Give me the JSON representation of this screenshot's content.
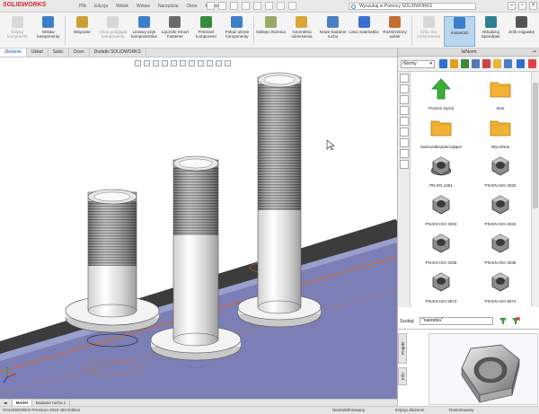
{
  "app": {
    "logo": "SOLIDWORKS"
  },
  "menu": [
    "Plik",
    "Edycja",
    "Widok",
    "Wstaw",
    "Narzędzia",
    "Okno",
    "Pomoc"
  ],
  "help_search": "Wyszukaj w Pomocy SOLIDWORKS",
  "ribbon": [
    {
      "label": "Edytuj komponent",
      "disabled": true
    },
    {
      "label": "Wstaw komponenty",
      "disabled": false
    },
    {
      "label": "Wiązanie",
      "disabled": false
    },
    {
      "label": "Okno podglądu komponentu",
      "disabled": true
    },
    {
      "label": "Liniowy szyk komponentów",
      "disabled": false
    },
    {
      "label": "Łączniki Smart Fastener",
      "disabled": false
    },
    {
      "label": "Przenieś komponent",
      "disabled": false
    },
    {
      "label": "Pokaż ukryte komponenty",
      "disabled": false
    },
    {
      "label": "Odstęp złożenia",
      "disabled": false
    },
    {
      "label": "Geometria odniesienia",
      "disabled": false
    },
    {
      "label": "Nowe badanie ruchu",
      "disabled": false
    },
    {
      "label": "Lista materiałów",
      "disabled": false
    },
    {
      "label": "Rozstrzelony widok",
      "disabled": false
    },
    {
      "label": "Szkic linii rozstrzelenia",
      "disabled": true
    },
    {
      "label": "Instant3D",
      "disabled": false,
      "active": true
    },
    {
      "label": "Aktualizuj Speedpak",
      "disabled": false
    },
    {
      "label": "Zrób migawkę",
      "disabled": false
    }
  ],
  "tabs": [
    "Złożenie",
    "Układ",
    "Szkic",
    "Ocen",
    "Dodatki SOLIDWORKS"
  ],
  "bottom_tabs": [
    "Model",
    "Badanie ruchu 1"
  ],
  "status": {
    "left": "SOLIDWORKS Premium 2016 x64 Edition",
    "s1": "Niedodefiniowany",
    "s2": "Edycja Złożenie",
    "s3": "Dostosowany"
  },
  "panel": {
    "title": "IsiNorm",
    "filter_value": "Normy",
    "items": [
      {
        "label": "Poziom wyżej",
        "kind": "up"
      },
      {
        "label": "Inne",
        "kind": "folder"
      },
      {
        "label": "Samozabezpieczające",
        "kind": "folder"
      },
      {
        "label": "Wycofane",
        "kind": "folder"
      },
      {
        "label": "PN-EN 1661",
        "kind": "nut-flange"
      },
      {
        "label": "PN-EN ISO 4032",
        "kind": "nut"
      },
      {
        "label": "PN-EN ISO 4033",
        "kind": "nut"
      },
      {
        "label": "PN-EN ISO 4034",
        "kind": "nut"
      },
      {
        "label": "PN-EN ISO 4035",
        "kind": "nut"
      },
      {
        "label": "PN-EN ISO 4036",
        "kind": "nut"
      },
      {
        "label": "PN-EN ISO 8673",
        "kind": "nut"
      },
      {
        "label": "PN-EN ISO 8674",
        "kind": "nut"
      }
    ],
    "search_label": "Szukaj:",
    "search_value": "\"nakrętka\"",
    "side_tabs": [
      "Projekt",
      "Info"
    ]
  },
  "colors": {
    "accent": "#0a4fa3",
    "folder": "#f2b233",
    "up_arrow": "#3cae3a",
    "beam_top": "#3a3a3a",
    "beam_side": "#7d80b4",
    "sketch": "#e0661a"
  }
}
